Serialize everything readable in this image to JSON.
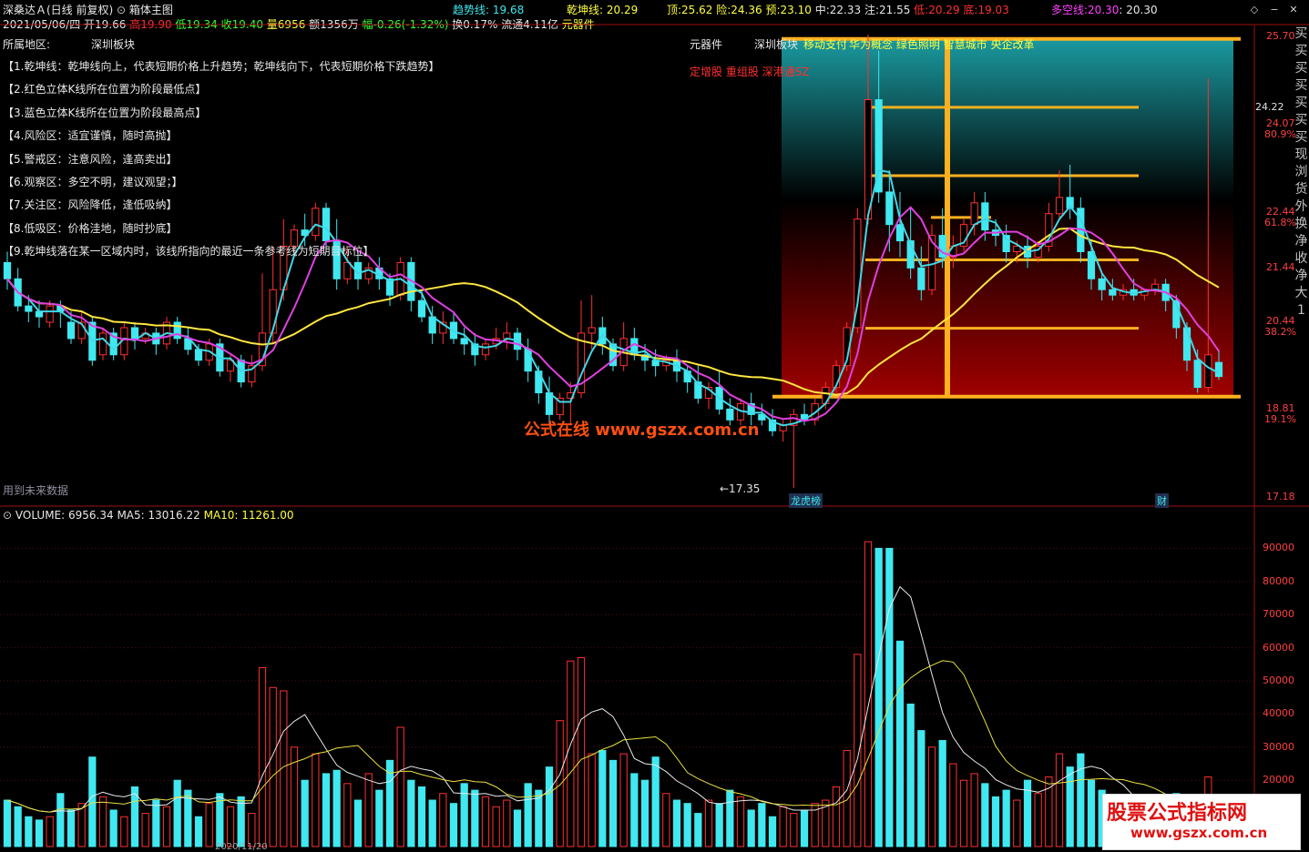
{
  "header": {
    "stock_name": "深桑达Ａ(日线 前复权)",
    "indicator_name": "箱体主图",
    "trend_label": "趋势线:",
    "trend_value": "19.68",
    "qiankun_label": "乾坤线:",
    "qiankun_value": "20.29",
    "top_label": "顶:",
    "top_value": "25.62",
    "risk_label": "险:",
    "risk_value": "24.36",
    "pre_label": "预:",
    "pre_value": "23.10",
    "mid_label": "中:",
    "mid_value": "22.33",
    "note_label": "注:",
    "note_value": "21.55",
    "low_label": "低:",
    "low_value": "20.29",
    "bottom_label": "底:",
    "bottom_value": "19.03",
    "duokong_label": "多空线:",
    "duokong_value": "20.30",
    "duokong_value2": ": 20.30",
    "date": "2021/05/06/四",
    "open": "开19.66",
    "high": "高19.90",
    "low": "低19.34",
    "close": "收19.40",
    "volume": "量6956",
    "amount": "额1356万",
    "change": "幅-0.26(-1.32%)",
    "turnover": "换0.17%",
    "float": "流通4.11亿",
    "unit": "元器件"
  },
  "info": {
    "region_label": "所属地区:",
    "region_value": "深圳板块",
    "industry": "元器件",
    "board": "深圳板块",
    "concepts": "华为概念 绿色照明 智慧城市 央企改革",
    "concepts_prefix": "移动支付",
    "tags": "定增股 重组股 深港通SZ",
    "notes": [
      "【1.乾坤线：乾坤线向上，代表短期价格上升趋势；乾坤线向下，代表短期价格下跌趋势】",
      "【2.红色立体K线所在位置为阶段最低点】",
      "【3.蓝色立体K线所在位置为阶段最高点】",
      "【4.风险区：适宜谨慎，随时高抛】",
      "【5.警戒区：注意风险，逢高卖出】",
      "【6.观察区：多空不明，建议观望；】",
      "【7.关注区：风险降低，逢低吸纳】",
      "【8.低吸区：价格洼地，随时抄底】",
      "【9.乾坤线落在某一区域内时，该线所指向的最近一条参考线为短期目标位】"
    ],
    "future_data": "用到未来数据",
    "min_marker": "←17.35",
    "watermark": "公式在线 www.gszx.com.cn",
    "marker_dragon": "龙虎榜",
    "marker_fin": "财"
  },
  "price_axis": {
    "labels": [
      "25.70",
      "24.22",
      "24.07",
      "80.9%",
      "22.44",
      "61.8%",
      "21.44",
      "20.44",
      "38.2%",
      "18.81",
      "19.1%",
      "17.18"
    ],
    "right_strip_chars": [
      "买",
      "买",
      "买",
      "买",
      "买",
      "买",
      "买",
      "现",
      "浏",
      "货",
      "外",
      "换",
      "净",
      "收",
      "净",
      "大",
      "1"
    ]
  },
  "volume": {
    "title": "VOLUME: 6956.34",
    "ma5": "MA5: 13016.22",
    "ma10": "MA10: 11261.00",
    "axis_labels": [
      "90000",
      "80000",
      "70000",
      "60000",
      "50000",
      "40000",
      "30000",
      "20000"
    ],
    "date_labels": [
      "2020/11/20",
      "1"
    ]
  },
  "banner": {
    "title": "股票公式指标网",
    "url": "www.gszx.com.cn"
  },
  "colors": {
    "up": "#ff3030",
    "down": "#40e8f0",
    "yellow_line": "#ffe640",
    "cyan_line": "#40d8e8",
    "magenta_line": "#e040e0",
    "box_orange": "#ffb020"
  },
  "chart_data": {
    "type": "candlestick",
    "title": "箱体主图",
    "price_range": [
      17.18,
      25.7
    ],
    "volume_range": [
      0,
      100000
    ],
    "box_levels": {
      "top": 25.62,
      "risk": 24.36,
      "pre": 23.1,
      "mid": 22.33,
      "note": 21.55,
      "low": 20.29,
      "bottom": 19.03
    },
    "candles": [
      {
        "o": 21.5,
        "h": 21.7,
        "c": 21.2,
        "l": 21.0,
        "v": 14000
      },
      {
        "o": 21.2,
        "h": 21.4,
        "c": 20.7,
        "l": 20.6,
        "v": 12000
      },
      {
        "o": 20.7,
        "h": 20.9,
        "c": 20.6,
        "l": 20.4,
        "v": 9000
      },
      {
        "o": 20.6,
        "h": 20.8,
        "c": 20.5,
        "l": 20.3,
        "v": 8000
      },
      {
        "o": 20.4,
        "h": 20.8,
        "c": 20.7,
        "l": 20.3,
        "v": 9000
      },
      {
        "o": 20.7,
        "h": 20.8,
        "c": 20.6,
        "l": 20.3,
        "v": 16000
      },
      {
        "o": 20.4,
        "h": 20.6,
        "c": 20.1,
        "l": 20.0,
        "v": 11000
      },
      {
        "o": 20.1,
        "h": 20.6,
        "c": 20.4,
        "l": 20.0,
        "v": 13000
      },
      {
        "o": 20.4,
        "h": 20.5,
        "c": 19.7,
        "l": 19.6,
        "v": 27000
      },
      {
        "o": 19.8,
        "h": 20.3,
        "c": 20.2,
        "l": 19.7,
        "v": 15000
      },
      {
        "o": 20.2,
        "h": 20.3,
        "c": 19.8,
        "l": 19.7,
        "v": 11000
      },
      {
        "o": 19.8,
        "h": 20.4,
        "c": 20.3,
        "l": 19.7,
        "v": 9000
      },
      {
        "o": 20.3,
        "h": 20.4,
        "c": 20.1,
        "l": 19.9,
        "v": 18000
      },
      {
        "o": 20.1,
        "h": 20.3,
        "c": 20.2,
        "l": 20.0,
        "v": 10000
      },
      {
        "o": 20.2,
        "h": 20.3,
        "c": 20.0,
        "l": 19.8,
        "v": 14000
      },
      {
        "o": 20.0,
        "h": 20.5,
        "c": 20.4,
        "l": 19.9,
        "v": 12000
      },
      {
        "o": 20.4,
        "h": 20.5,
        "c": 20.1,
        "l": 20.0,
        "v": 20000
      },
      {
        "o": 20.1,
        "h": 20.3,
        "c": 19.9,
        "l": 19.8,
        "v": 17000
      },
      {
        "o": 19.9,
        "h": 20.0,
        "c": 19.7,
        "l": 19.6,
        "v": 9000
      },
      {
        "o": 19.7,
        "h": 20.1,
        "c": 20.0,
        "l": 19.6,
        "v": 13000
      },
      {
        "o": 20.0,
        "h": 20.1,
        "c": 19.5,
        "l": 19.4,
        "v": 16000
      },
      {
        "o": 19.5,
        "h": 19.8,
        "c": 19.7,
        "l": 19.3,
        "v": 12000
      },
      {
        "o": 19.7,
        "h": 19.8,
        "c": 19.3,
        "l": 19.2,
        "v": 15000
      },
      {
        "o": 19.3,
        "h": 19.8,
        "c": 19.6,
        "l": 19.2,
        "v": 10000
      },
      {
        "o": 19.6,
        "h": 21.3,
        "c": 20.2,
        "l": 19.5,
        "v": 54000
      },
      {
        "o": 20.2,
        "h": 21.8,
        "c": 21.0,
        "l": 20.0,
        "v": 48000
      },
      {
        "o": 21.0,
        "h": 22.3,
        "c": 21.8,
        "l": 20.8,
        "v": 47000
      },
      {
        "o": 21.8,
        "h": 22.2,
        "c": 22.1,
        "l": 21.6,
        "v": 30000
      },
      {
        "o": 22.1,
        "h": 22.4,
        "c": 22.0,
        "l": 21.8,
        "v": 20000
      },
      {
        "o": 22.0,
        "h": 22.6,
        "c": 22.5,
        "l": 21.9,
        "v": 28000
      },
      {
        "o": 22.5,
        "h": 22.6,
        "c": 21.9,
        "l": 21.7,
        "v": 22000
      },
      {
        "o": 21.9,
        "h": 22.3,
        "c": 21.2,
        "l": 21.0,
        "v": 23000
      },
      {
        "o": 21.2,
        "h": 21.8,
        "c": 21.5,
        "l": 21.1,
        "v": 19000
      },
      {
        "o": 21.5,
        "h": 21.7,
        "c": 21.2,
        "l": 21.0,
        "v": 14000
      },
      {
        "o": 21.2,
        "h": 21.5,
        "c": 21.4,
        "l": 21.1,
        "v": 22000
      },
      {
        "o": 21.4,
        "h": 21.6,
        "c": 21.2,
        "l": 21.0,
        "v": 17000
      },
      {
        "o": 21.2,
        "h": 21.3,
        "c": 20.9,
        "l": 20.7,
        "v": 26000
      },
      {
        "o": 20.9,
        "h": 21.6,
        "c": 21.5,
        "l": 20.8,
        "v": 36000
      },
      {
        "o": 21.5,
        "h": 21.6,
        "c": 20.8,
        "l": 20.6,
        "v": 20000
      },
      {
        "o": 20.8,
        "h": 21.0,
        "c": 20.5,
        "l": 20.4,
        "v": 18000
      },
      {
        "o": 20.5,
        "h": 20.7,
        "c": 20.2,
        "l": 20.0,
        "v": 14000
      },
      {
        "o": 20.2,
        "h": 20.6,
        "c": 20.4,
        "l": 20.0,
        "v": 16000
      },
      {
        "o": 20.4,
        "h": 20.6,
        "c": 20.1,
        "l": 20.0,
        "v": 13000
      },
      {
        "o": 20.1,
        "h": 20.3,
        "c": 20.0,
        "l": 19.8,
        "v": 19000
      },
      {
        "o": 20.0,
        "h": 20.2,
        "c": 19.8,
        "l": 19.6,
        "v": 17000
      },
      {
        "o": 19.8,
        "h": 20.1,
        "c": 20.0,
        "l": 19.7,
        "v": 15000
      },
      {
        "o": 20.0,
        "h": 20.3,
        "c": 20.1,
        "l": 19.9,
        "v": 12000
      },
      {
        "o": 20.1,
        "h": 20.4,
        "c": 20.2,
        "l": 19.9,
        "v": 14000
      },
      {
        "o": 20.2,
        "h": 20.3,
        "c": 19.9,
        "l": 19.7,
        "v": 11000
      },
      {
        "o": 19.9,
        "h": 20.1,
        "c": 19.5,
        "l": 19.3,
        "v": 19000
      },
      {
        "o": 19.5,
        "h": 19.6,
        "c": 19.1,
        "l": 18.9,
        "v": 17000
      },
      {
        "o": 19.1,
        "h": 19.4,
        "c": 18.7,
        "l": 18.5,
        "v": 24000
      },
      {
        "o": 18.7,
        "h": 19.1,
        "c": 19.0,
        "l": 18.6,
        "v": 38000
      },
      {
        "o": 19.0,
        "h": 19.3,
        "c": 19.1,
        "l": 18.5,
        "v": 56000
      },
      {
        "o": 19.1,
        "h": 20.8,
        "c": 20.2,
        "l": 19.0,
        "v": 57000
      },
      {
        "o": 20.2,
        "h": 20.9,
        "c": 20.3,
        "l": 19.9,
        "v": 28000
      },
      {
        "o": 20.3,
        "h": 20.5,
        "c": 20.0,
        "l": 19.8,
        "v": 29000
      },
      {
        "o": 20.0,
        "h": 20.1,
        "c": 19.6,
        "l": 19.5,
        "v": 26000
      },
      {
        "o": 19.6,
        "h": 20.4,
        "c": 20.1,
        "l": 19.5,
        "v": 28000
      },
      {
        "o": 20.1,
        "h": 20.3,
        "c": 19.8,
        "l": 19.7,
        "v": 22000
      },
      {
        "o": 19.8,
        "h": 20.0,
        "c": 19.7,
        "l": 19.5,
        "v": 20000
      },
      {
        "o": 19.7,
        "h": 19.9,
        "c": 19.6,
        "l": 19.4,
        "v": 27000
      },
      {
        "o": 19.6,
        "h": 19.8,
        "c": 19.7,
        "l": 19.5,
        "v": 16000
      },
      {
        "o": 19.7,
        "h": 19.9,
        "c": 19.5,
        "l": 19.3,
        "v": 14000
      },
      {
        "o": 19.5,
        "h": 19.6,
        "c": 19.3,
        "l": 19.1,
        "v": 13000
      },
      {
        "o": 19.3,
        "h": 19.6,
        "c": 19.0,
        "l": 18.9,
        "v": 10000
      },
      {
        "o": 19.0,
        "h": 19.3,
        "c": 19.2,
        "l": 18.8,
        "v": 14000
      },
      {
        "o": 19.2,
        "h": 19.5,
        "c": 18.8,
        "l": 18.7,
        "v": 13000
      },
      {
        "o": 18.8,
        "h": 19.0,
        "c": 18.6,
        "l": 18.5,
        "v": 17000
      },
      {
        "o": 18.6,
        "h": 19.0,
        "c": 18.9,
        "l": 18.5,
        "v": 15000
      },
      {
        "o": 18.9,
        "h": 19.1,
        "c": 18.7,
        "l": 18.5,
        "v": 11000
      },
      {
        "o": 18.7,
        "h": 18.9,
        "c": 18.6,
        "l": 18.5,
        "v": 13000
      },
      {
        "o": 18.6,
        "h": 18.8,
        "c": 18.4,
        "l": 18.3,
        "v": 9000
      },
      {
        "o": 18.4,
        "h": 18.6,
        "c": 18.5,
        "l": 18.2,
        "v": 12000
      },
      {
        "o": 18.5,
        "h": 18.8,
        "c": 18.7,
        "l": 17.35,
        "v": 10000
      },
      {
        "o": 18.7,
        "h": 18.9,
        "c": 18.6,
        "l": 18.5,
        "v": 11000
      },
      {
        "o": 18.6,
        "h": 19.0,
        "c": 18.9,
        "l": 18.5,
        "v": 13000
      },
      {
        "o": 18.9,
        "h": 19.3,
        "c": 19.2,
        "l": 18.8,
        "v": 14000
      },
      {
        "o": 19.2,
        "h": 19.7,
        "c": 19.6,
        "l": 19.1,
        "v": 18000
      },
      {
        "o": 19.6,
        "h": 20.4,
        "c": 20.3,
        "l": 19.5,
        "v": 29000
      },
      {
        "o": 20.3,
        "h": 22.5,
        "c": 22.3,
        "l": 20.2,
        "v": 58000
      },
      {
        "o": 22.3,
        "h": 25.7,
        "c": 24.5,
        "l": 22.2,
        "v": 92000
      },
      {
        "o": 24.5,
        "h": 25.4,
        "c": 22.8,
        "l": 22.6,
        "v": 90000
      },
      {
        "o": 22.8,
        "h": 23.2,
        "c": 22.2,
        "l": 21.7,
        "v": 90000
      },
      {
        "o": 22.2,
        "h": 22.8,
        "c": 21.9,
        "l": 21.6,
        "v": 62000
      },
      {
        "o": 21.9,
        "h": 22.5,
        "c": 21.4,
        "l": 21.2,
        "v": 43000
      },
      {
        "o": 21.4,
        "h": 21.8,
        "c": 21.0,
        "l": 20.8,
        "v": 35000
      },
      {
        "o": 21.0,
        "h": 22.2,
        "c": 22.0,
        "l": 20.9,
        "v": 30000
      },
      {
        "o": 22.0,
        "h": 22.5,
        "c": 21.6,
        "l": 21.4,
        "v": 32000
      },
      {
        "o": 21.6,
        "h": 22.0,
        "c": 21.8,
        "l": 21.4,
        "v": 25000
      },
      {
        "o": 21.8,
        "h": 22.3,
        "c": 22.2,
        "l": 21.7,
        "v": 20000
      },
      {
        "o": 22.2,
        "h": 22.8,
        "c": 22.6,
        "l": 22.0,
        "v": 22000
      },
      {
        "o": 22.6,
        "h": 22.8,
        "c": 22.1,
        "l": 21.9,
        "v": 19000
      },
      {
        "o": 22.1,
        "h": 22.3,
        "c": 22.0,
        "l": 21.8,
        "v": 15000
      },
      {
        "o": 22.0,
        "h": 22.2,
        "c": 21.7,
        "l": 21.5,
        "v": 17000
      },
      {
        "o": 21.7,
        "h": 21.9,
        "c": 21.8,
        "l": 21.5,
        "v": 14000
      },
      {
        "o": 21.8,
        "h": 22.0,
        "c": 21.6,
        "l": 21.4,
        "v": 20000
      },
      {
        "o": 21.6,
        "h": 21.9,
        "c": 21.8,
        "l": 21.5,
        "v": 16000
      },
      {
        "o": 21.8,
        "h": 22.6,
        "c": 22.4,
        "l": 21.7,
        "v": 21000
      },
      {
        "o": 22.4,
        "h": 23.2,
        "c": 22.7,
        "l": 22.3,
        "v": 28000
      },
      {
        "o": 22.7,
        "h": 23.3,
        "c": 22.5,
        "l": 22.3,
        "v": 24000
      },
      {
        "o": 22.5,
        "h": 22.7,
        "c": 21.7,
        "l": 21.5,
        "v": 28000
      },
      {
        "o": 21.7,
        "h": 21.9,
        "c": 21.2,
        "l": 21.0,
        "v": 20000
      },
      {
        "o": 21.2,
        "h": 21.3,
        "c": 21.0,
        "l": 20.8,
        "v": 17000
      },
      {
        "o": 21.0,
        "h": 21.2,
        "c": 20.9,
        "l": 20.8,
        "v": 15000
      },
      {
        "o": 20.9,
        "h": 21.1,
        "c": 21.0,
        "l": 20.8,
        "v": 13000
      },
      {
        "o": 21.0,
        "h": 21.2,
        "c": 20.9,
        "l": 20.8,
        "v": 11000
      },
      {
        "o": 20.9,
        "h": 21.0,
        "c": 21.0,
        "l": 20.8,
        "v": 10000
      },
      {
        "o": 21.0,
        "h": 21.2,
        "c": 21.1,
        "l": 20.9,
        "v": 9000
      },
      {
        "o": 21.1,
        "h": 21.2,
        "c": 20.8,
        "l": 20.6,
        "v": 11000
      },
      {
        "o": 20.8,
        "h": 20.9,
        "c": 20.3,
        "l": 20.1,
        "v": 16000
      },
      {
        "o": 20.3,
        "h": 20.4,
        "c": 19.7,
        "l": 19.5,
        "v": 13000
      },
      {
        "o": 19.7,
        "h": 19.9,
        "c": 19.2,
        "l": 19.1,
        "v": 12000
      },
      {
        "o": 19.2,
        "h": 24.9,
        "c": 19.8,
        "l": 19.1,
        "v": 21000
      },
      {
        "o": 19.66,
        "h": 19.9,
        "c": 19.4,
        "l": 19.34,
        "v": 6956
      }
    ]
  }
}
